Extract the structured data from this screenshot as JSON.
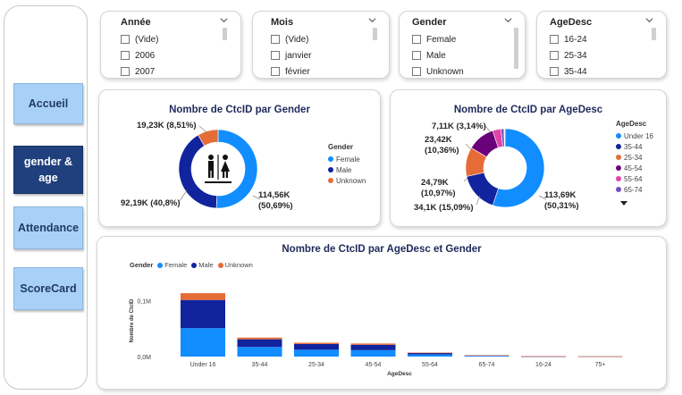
{
  "nav": {
    "items": [
      {
        "label": "Accueil",
        "active": false
      },
      {
        "label": "gender &\nage",
        "active": true
      },
      {
        "label": "Attendance",
        "active": false
      },
      {
        "label": "ScoreCard",
        "active": false
      }
    ]
  },
  "slicers": [
    {
      "title": "Année",
      "items": [
        "(Vide)",
        "2006",
        "2007"
      ]
    },
    {
      "title": "Mois",
      "items": [
        "(Vide)",
        "janvier",
        "février"
      ]
    },
    {
      "title": "Gender",
      "items": [
        "Female",
        "Male",
        "Unknown"
      ]
    },
    {
      "title": "AgeDesc",
      "items": [
        "16-24",
        "25-34",
        "35-44"
      ]
    }
  ],
  "colors": {
    "female": "#118dff",
    "male": "#12239e",
    "unknown": "#e66c37",
    "age_under16": "#118dff",
    "age_35_44": "#12239e",
    "age_25_34": "#e66c37",
    "age_45_54": "#6b007b",
    "age_55_64": "#e044a7",
    "age_65_74": "#744ec2",
    "age_16_24": "#d9b300",
    "age_75plus": "#d64550"
  },
  "gender_donut": {
    "title": "Nombre de CtcID par Gender",
    "legend_title": "Gender",
    "icon": "restroom-icon",
    "labels": {
      "female": "114,56K\n(50,69%)",
      "male": "92,19K (40,8%)",
      "unknown": "19,23K (8,51%)"
    }
  },
  "age_donut": {
    "title": "Nombre de CtcID par AgeDesc",
    "legend_title": "AgeDesc",
    "legend_items": [
      "Under 16",
      "35-44",
      "25-34",
      "45-54",
      "55-64",
      "65-74"
    ],
    "labels": {
      "under16": "113,69K\n(50,31%)",
      "age_35_44": "34,1K (15,09%)",
      "age_25_34": "24,79K\n(10,97%)",
      "age_45_54": "23,42K\n(10,36%)",
      "age_55_64": "7,11K (3,14%)"
    }
  },
  "bar_chart": {
    "title": "Nombre de CtcID par AgeDesc et Gender",
    "legend_title": "Gender",
    "legend_items": [
      "Female",
      "Male",
      "Unknown"
    ],
    "xlabel": "AgeDesc",
    "ylabel": "Nombre de CtcID",
    "yticks": [
      "0,1M",
      "0,0M"
    ]
  },
  "chart_data": [
    {
      "type": "pie",
      "title": "Nombre de CtcID par Gender",
      "categories": [
        "Female",
        "Male",
        "Unknown"
      ],
      "values": [
        114560,
        92190,
        19230
      ],
      "legend_placement": "right"
    },
    {
      "type": "pie",
      "title": "Nombre de CtcID par AgeDesc",
      "categories": [
        "Under 16",
        "35-44",
        "25-34",
        "45-54",
        "55-64",
        "65-74",
        "16-24",
        "75+"
      ],
      "values": [
        113690,
        34100,
        24790,
        23420,
        7110,
        2500,
        600,
        300
      ],
      "legend_placement": "right"
    },
    {
      "type": "bar",
      "title": "Nombre de CtcID par AgeDesc et Gender",
      "xlabel": "AgeDesc",
      "ylabel": "Nombre de CtcID",
      "categories": [
        "Under 16",
        "35-44",
        "25-34",
        "45-54",
        "55-64",
        "65-74",
        "16-24",
        "75+"
      ],
      "series": [
        {
          "name": "Female",
          "values": [
            51000,
            17200,
            12300,
            11500,
            3800,
            1300,
            300,
            150
          ]
        },
        {
          "name": "Male",
          "values": [
            50500,
            13800,
            10200,
            9700,
            2800,
            1000,
            250,
            120
          ]
        },
        {
          "name": "Unknown",
          "values": [
            12200,
            3100,
            2290,
            2220,
            510,
            200,
            50,
            30
          ]
        }
      ],
      "ylim": [
        0,
        125000
      ],
      "grid": false,
      "legend_placement": "top-left"
    }
  ]
}
